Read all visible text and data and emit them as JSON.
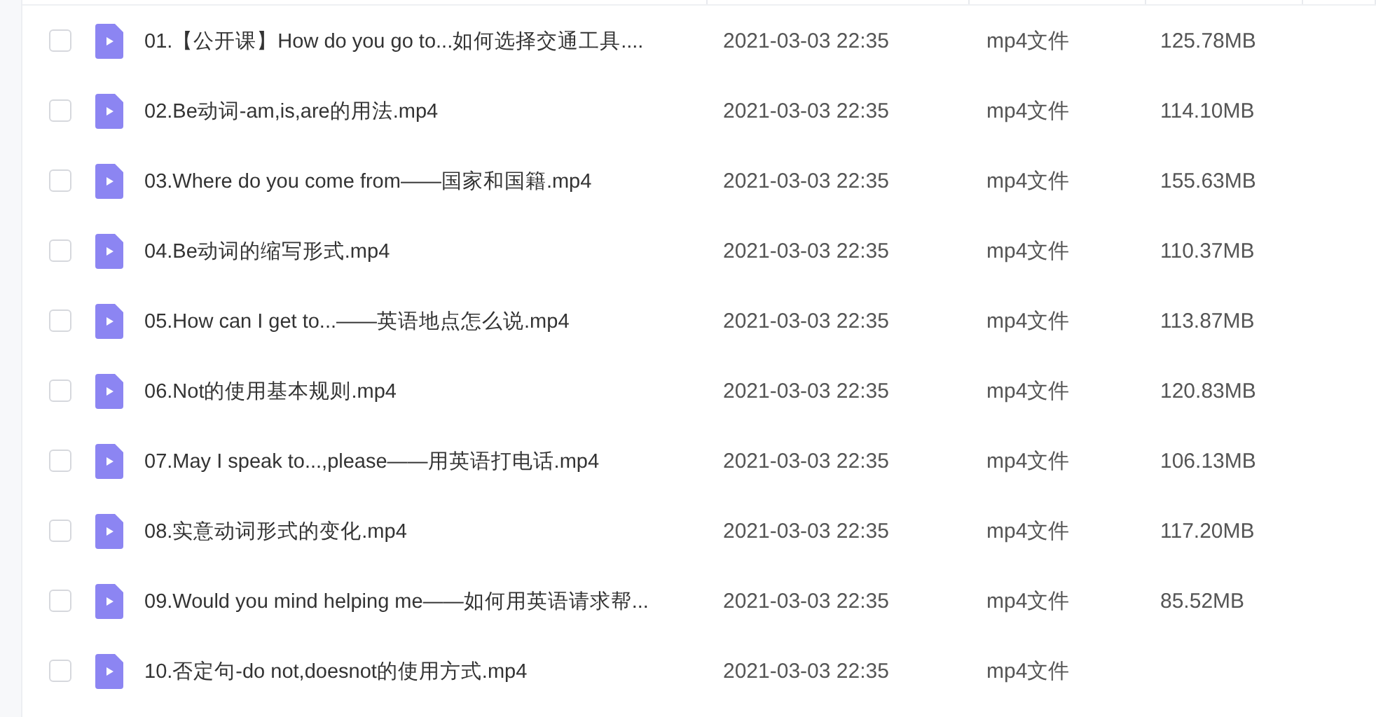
{
  "files": [
    {
      "name": "01.【公开课】How do you go to...如何选择交通工具....",
      "modified": "2021-03-03 22:35",
      "type": "mp4文件",
      "size": "125.78MB",
      "checked": false
    },
    {
      "name": "02.Be动词-am,is,are的用法.mp4",
      "modified": "2021-03-03 22:35",
      "type": "mp4文件",
      "size": "114.10MB",
      "checked": false
    },
    {
      "name": "03.Where do you come from——国家和国籍.mp4",
      "modified": "2021-03-03 22:35",
      "type": "mp4文件",
      "size": "155.63MB",
      "checked": false
    },
    {
      "name": "04.Be动词的缩写形式.mp4",
      "modified": "2021-03-03 22:35",
      "type": "mp4文件",
      "size": "110.37MB",
      "checked": false
    },
    {
      "name": "05.How can I get to...——英语地点怎么说.mp4",
      "modified": "2021-03-03 22:35",
      "type": "mp4文件",
      "size": "113.87MB",
      "checked": false
    },
    {
      "name": "06.Not的使用基本规则.mp4",
      "modified": "2021-03-03 22:35",
      "type": "mp4文件",
      "size": "120.83MB",
      "checked": false
    },
    {
      "name": "07.May I speak to...,please——用英语打电话.mp4",
      "modified": "2021-03-03 22:35",
      "type": "mp4文件",
      "size": "106.13MB",
      "checked": false
    },
    {
      "name": "08.实意动词形式的变化.mp4",
      "modified": "2021-03-03 22:35",
      "type": "mp4文件",
      "size": "117.20MB",
      "checked": false
    },
    {
      "name": "09.Would you mind helping me——如何用英语请求帮...",
      "modified": "2021-03-03 22:35",
      "type": "mp4文件",
      "size": "85.52MB",
      "checked": false
    },
    {
      "name": "10.否定句-do not,doesnot的使用方式.mp4",
      "modified": "2021-03-03 22:35",
      "type": "mp4文件",
      "checked": false
    }
  ]
}
